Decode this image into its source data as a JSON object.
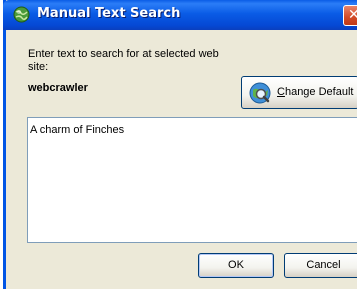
{
  "window": {
    "title": "Manual Text Search",
    "close_glyph": "✕"
  },
  "prompt": {
    "text": "Enter text to search for at selected web site:",
    "site_name": "webcrawler"
  },
  "buttons": {
    "change_default": "Change Default",
    "ok": "OK",
    "cancel": "Cancel"
  },
  "search": {
    "value": "A charm of Finches"
  },
  "icons": {
    "title": "globe-search-icon",
    "change_default": "globe-magnifier-icon"
  },
  "colors": {
    "titlebar": "#0a5ce6",
    "close": "#d24a27",
    "dialog_bg": "#ece9d8"
  }
}
